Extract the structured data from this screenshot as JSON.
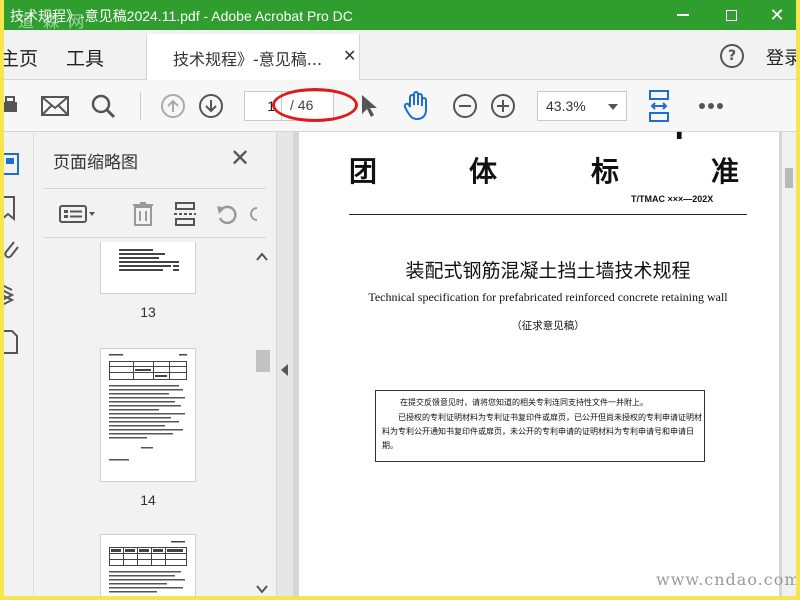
{
  "window": {
    "title": "技术规程》-意见稿2024.11.pdf - Adobe Acrobat Pro DC",
    "watermark_top": "道 森 网"
  },
  "tabs": {
    "home_label": "主页",
    "tools_label": "工具",
    "doc_tab_label": "技术规程》-意见稿...",
    "login_label": "登录"
  },
  "toolbar": {
    "current_page": "1",
    "page_total": "/ 46",
    "zoom": "43.3%"
  },
  "thumbnails_panel": {
    "title": "页面缩略图",
    "thumbnails": [
      {
        "page": "13"
      },
      {
        "page": "14"
      },
      {
        "page": ""
      }
    ]
  },
  "document": {
    "header_chars": [
      "团",
      "体",
      "标",
      "准"
    ],
    "standard_code": "T/TMAC  ×××—202X",
    "title_cn": "装配式钢筋混凝土挡土墙技术规程",
    "title_en": "Technical specification for prefabricated reinforced concrete retaining wall",
    "draft_note": "（征求意见稿）",
    "notice_line1": "在提交反馈意见时，请将您知道的相关专利连同支持性文件一并附上。",
    "notice_line2": "已授权的专利证明材料为专利证书复印件或扉页，已公开但尚未授权的专利申请证明材料为专利公开通知书复印件或扉页，未公开的专利申请的证明材料为专利申请号和申请日期。"
  },
  "watermark_bottom": "www.cndao.com",
  "colors": {
    "titlebar": "#2f9e2f",
    "highlight_oval": "#e01a1a",
    "tool_blue": "#1a6fd1",
    "outer_border": "#f7e54a"
  }
}
